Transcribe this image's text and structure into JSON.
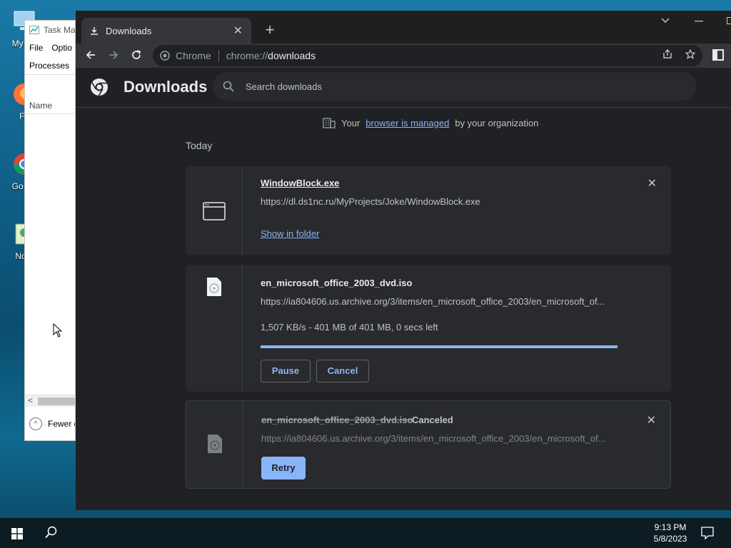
{
  "desktop": {
    "icons": [
      {
        "label": "My Co"
      },
      {
        "label": "Fir"
      },
      {
        "label": "Go Ch"
      },
      {
        "label": "Note"
      }
    ]
  },
  "task_manager": {
    "title": "Task Ma",
    "menu": [
      "File",
      "Optio"
    ],
    "tab": "Processes",
    "column": "Name",
    "scroll_left": "<",
    "fewer_details": "Fewer d"
  },
  "chrome": {
    "tab_title": "Downloads",
    "tab_close": "✕",
    "new_tab": "+",
    "omnibox": {
      "site": "Chrome",
      "scheme": "chrome://",
      "host": "downloads"
    },
    "page_title": "Downloads",
    "search_placeholder": "Search downloads",
    "managed": {
      "pre": "Your",
      "link": "browser is managed",
      "post": "by your organization"
    },
    "date_header": "Today",
    "downloads": [
      {
        "filename": "WindowBlock.exe",
        "url": "https://dl.ds1nc.ru/MyProjects/Joke/WindowBlock.exe",
        "action_link": "Show in folder",
        "remove": "✕"
      },
      {
        "filename": "en_microsoft_office_2003_dvd.iso",
        "url": "https://ia804606.us.archive.org/3/items/en_microsoft_office_2003/en_microsoft_of...",
        "status": "1,507 KB/s - 401 MB of 401 MB, 0 secs left",
        "progress": 1.0,
        "pause": "Pause",
        "cancel": "Cancel"
      },
      {
        "filename": "en_microsoft_office_2003_dvd.iso",
        "state": "Canceled",
        "url": "https://ia804606.us.archive.org/3/items/en_microsoft_office_2003/en_microsoft_of...",
        "retry": "Retry",
        "remove": "✕"
      }
    ]
  },
  "taskbar": {
    "time": "9:13 PM",
    "date": "5/8/2023"
  },
  "colors": {
    "accent": "#8ab4f8",
    "page_bg": "#202124",
    "card_bg": "#292a2d"
  }
}
